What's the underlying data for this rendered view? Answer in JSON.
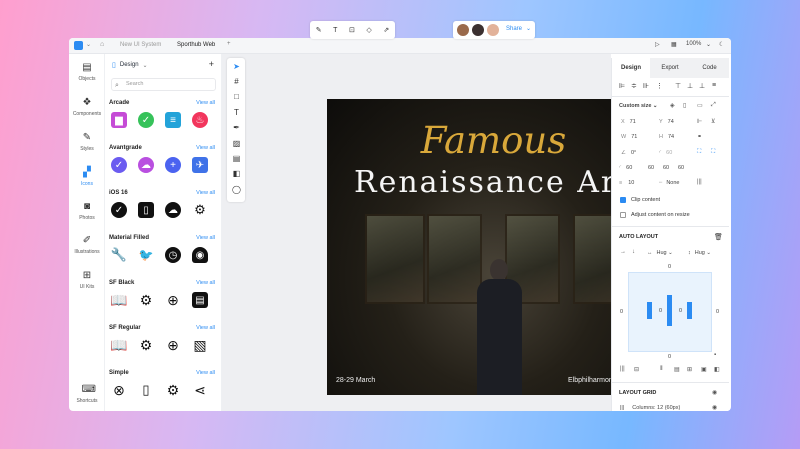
{
  "titlebar": {
    "tabs": [
      "New UI System",
      "Sporthub Web"
    ],
    "zoom": "100%"
  },
  "rail": {
    "items": [
      {
        "label": "Objects",
        "icon": "objects-icon"
      },
      {
        "label": "Components",
        "icon": "components-icon"
      },
      {
        "label": "Styles",
        "icon": "styles-icon"
      },
      {
        "label": "Icons",
        "icon": "icons-icon",
        "active": true
      },
      {
        "label": "Photos",
        "icon": "photos-icon"
      },
      {
        "label": "Illustrations",
        "icon": "illustrations-icon"
      },
      {
        "label": "UI Kits",
        "icon": "ui-kits-icon"
      },
      {
        "label": "Shortcuts",
        "icon": "shortcuts-icon"
      }
    ]
  },
  "library": {
    "title": "Design",
    "search_placeholder": "Search",
    "view_all": "View all",
    "sections": [
      {
        "title": "Arcade",
        "icons": [
          "trash-icon",
          "check-icon",
          "document-icon",
          "tinder-icon"
        ]
      },
      {
        "title": "Avantgrade",
        "icons": [
          "check-circle-icon",
          "cloud-download-icon",
          "plus-icon",
          "rocket-icon"
        ]
      },
      {
        "title": "iOS 16",
        "icons": [
          "check-circle-icon",
          "book-icon",
          "cloud-download-icon",
          "gears-icon"
        ]
      },
      {
        "title": "Material Filled",
        "icons": [
          "wrench-icon",
          "twitter-icon",
          "clock-icon",
          "android-icon"
        ]
      },
      {
        "title": "SF Black",
        "icons": [
          "book-icon",
          "gear-icon",
          "plus-circle-icon",
          "file-image-icon"
        ]
      },
      {
        "title": "SF Regular",
        "icons": [
          "book-icon",
          "gear-icon",
          "plus-circle-icon",
          "image-icon"
        ]
      },
      {
        "title": "Simple",
        "icons": [
          "close-circle-icon",
          "file-image-icon",
          "gear-icon",
          "share-icon"
        ]
      }
    ]
  },
  "toolbar": {
    "share": "Share"
  },
  "poster": {
    "title_script": "Famous",
    "title_main": "Renaissance Art",
    "date": "28-29 March",
    "venue": "Elbphilharmonie Hamburg"
  },
  "panel": {
    "tabs": [
      "Design",
      "Export",
      "Code"
    ],
    "size_label": "Custom size",
    "x": "71",
    "y": "74",
    "w": "71",
    "h": "74",
    "rotation": "0°",
    "radius": "60",
    "radius_corners": [
      "60",
      "60",
      "60",
      "60"
    ],
    "stroke": "10",
    "stroke_style": "None",
    "clip_content": "Clip content",
    "adjust_content": "Adjust content on resize",
    "auto_layout": "AUTO LAYOUT",
    "hug_w": "Hug",
    "hug_h": "Hug",
    "padding": [
      "0",
      "0",
      "0",
      "0",
      "0"
    ],
    "inner_values": [
      "0",
      "0"
    ],
    "layout_grid": "LAYOUT GRID",
    "columns": "Columns: 12 (60px)"
  },
  "colors": {
    "accent": "#2b8bf2",
    "title_gold": "#d9a83a"
  }
}
